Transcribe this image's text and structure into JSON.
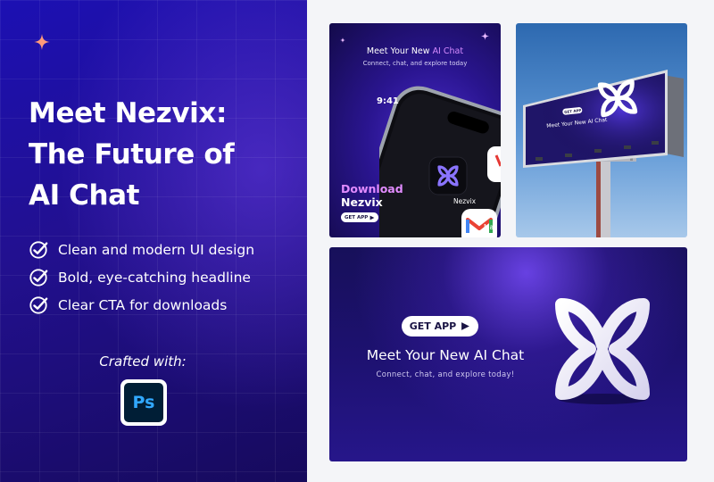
{
  "left_panel": {
    "headline_lines": [
      "Meet Nezvix:",
      "The Future of",
      "AI Chat"
    ],
    "features": [
      "Clean and modern UI design",
      "Bold, eye-catching headline",
      "Clear CTA for downloads"
    ],
    "crafted_with": "Crafted with:",
    "ps_logo_text": "Ps"
  },
  "card_phone": {
    "title_plain": "Meet Your New ",
    "title_accent": "AI Chat",
    "subtitle": "Connect, chat, and explore today",
    "phone_time": "9:41",
    "app_nezvix_label": "Nezvix",
    "app_mail_label": "Mail",
    "download_line1": "Download",
    "download_line2": "Nezvix",
    "get_app": "GET APP"
  },
  "card_billboard": {
    "get_app": "GET APP",
    "title": "Meet Your New AI Chat"
  },
  "card_banner": {
    "get_app": "GET APP",
    "title": "Meet Your New AI Chat",
    "subtitle": "Connect, chat, and explore today!"
  },
  "colors": {
    "brand_blue": "#1c10b3",
    "brand_purple": "#6a3cf0",
    "accent_pink": "#e28cff",
    "ps_blue": "#31a8ff"
  },
  "icons": [
    "sparkle-icon",
    "check-circle-icon",
    "photoshop-logo",
    "nezvix-logo",
    "play-icon",
    "gmail-icon"
  ]
}
